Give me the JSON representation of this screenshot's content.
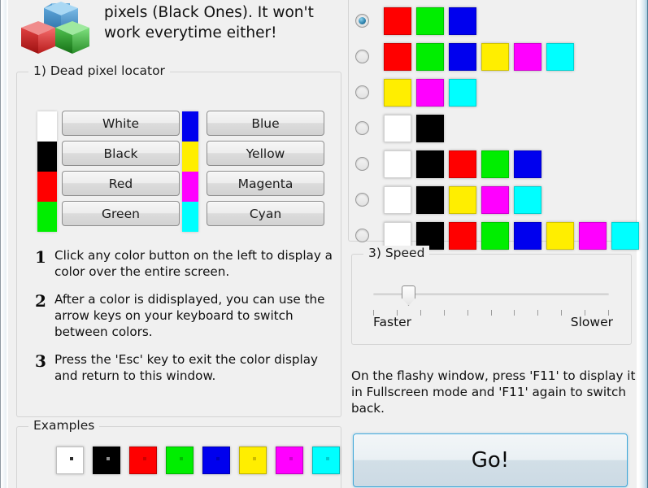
{
  "window": {
    "accent_border": "#4e7b95",
    "background": "#f0f0f0"
  },
  "header": {
    "logo_name": "rgb-cubes-logo",
    "description": "tool. It won't repair dead pixels (Black Ones). It won't work everytime either!"
  },
  "section1": {
    "title": "1)  Dead pixel locator",
    "strip_left_colors": [
      "#ffffff",
      "#000000",
      "#ff0000",
      "#00ee00"
    ],
    "strip_right_colors": [
      "#0000ee",
      "#ffee00",
      "#ff00ff",
      "#00ffff"
    ],
    "buttons": [
      {
        "label": "White",
        "color": "#ffffff"
      },
      {
        "label": "Black",
        "color": "#000000"
      },
      {
        "label": "Red",
        "color": "#ff0000"
      },
      {
        "label": "Green",
        "color": "#00ee00"
      },
      {
        "label": "Blue",
        "color": "#0000ee"
      },
      {
        "label": "Yellow",
        "color": "#ffee00"
      },
      {
        "label": "Magenta",
        "color": "#ff00ff"
      },
      {
        "label": "Cyan",
        "color": "#00ffff"
      }
    ],
    "steps": [
      {
        "num": "1",
        "text": "Click any color button on the left to display a color over the entire screen."
      },
      {
        "num": "2",
        "text": "After a color is didisplayed, you can use the arrow keys on your keyboard to switch between colors."
      },
      {
        "num": "3",
        "text": "Press the 'Esc' key to exit the color display and return to this window."
      }
    ]
  },
  "examples": {
    "title": "Examples",
    "swatches": [
      {
        "color": "#ffffff",
        "dot": "#2b2b2b"
      },
      {
        "color": "#000000",
        "dot": "#8f8f8f"
      },
      {
        "color": "#ff0000",
        "dot": "#cc0000"
      },
      {
        "color": "#00ee00",
        "dot": "#00bb00"
      },
      {
        "color": "#0000ee",
        "dot": "#0000bb"
      },
      {
        "color": "#ffee00",
        "dot": "#ccbb00"
      },
      {
        "color": "#ff00ff",
        "dot": "#cc00cc"
      },
      {
        "color": "#00ffff",
        "dot": "#00cccc"
      }
    ]
  },
  "section2": {
    "selected_index": 0,
    "rows": [
      {
        "colors": [
          "#ff0000",
          "#00ee00",
          "#0000ee"
        ]
      },
      {
        "colors": [
          "#ff0000",
          "#00ee00",
          "#0000ee",
          "#ffee00",
          "#ff00ff",
          "#00ffff"
        ]
      },
      {
        "colors": [
          "#ffee00",
          "#ff00ff",
          "#00ffff"
        ]
      },
      {
        "colors": [
          "#ffffff",
          "#000000"
        ]
      },
      {
        "colors": [
          "#ffffff",
          "#000000",
          "#ff0000",
          "#00ee00",
          "#0000ee"
        ]
      },
      {
        "colors": [
          "#ffffff",
          "#000000",
          "#ffee00",
          "#ff00ff",
          "#00ffff"
        ]
      },
      {
        "colors": [
          "#ffffff",
          "#000000",
          "#ff0000",
          "#00ee00",
          "#0000ee",
          "#ffee00",
          "#ff00ff",
          "#00ffff"
        ]
      }
    ]
  },
  "section3": {
    "title": "3)  Speed",
    "label_left": "Faster",
    "label_right": "Slower",
    "tick_count": 11,
    "thumb_position_percent": 13
  },
  "footer": {
    "note": "On the flashy window, press 'F11' to display it in Fullscreen mode and 'F11' again to switch back.",
    "go_label": "Go!"
  }
}
